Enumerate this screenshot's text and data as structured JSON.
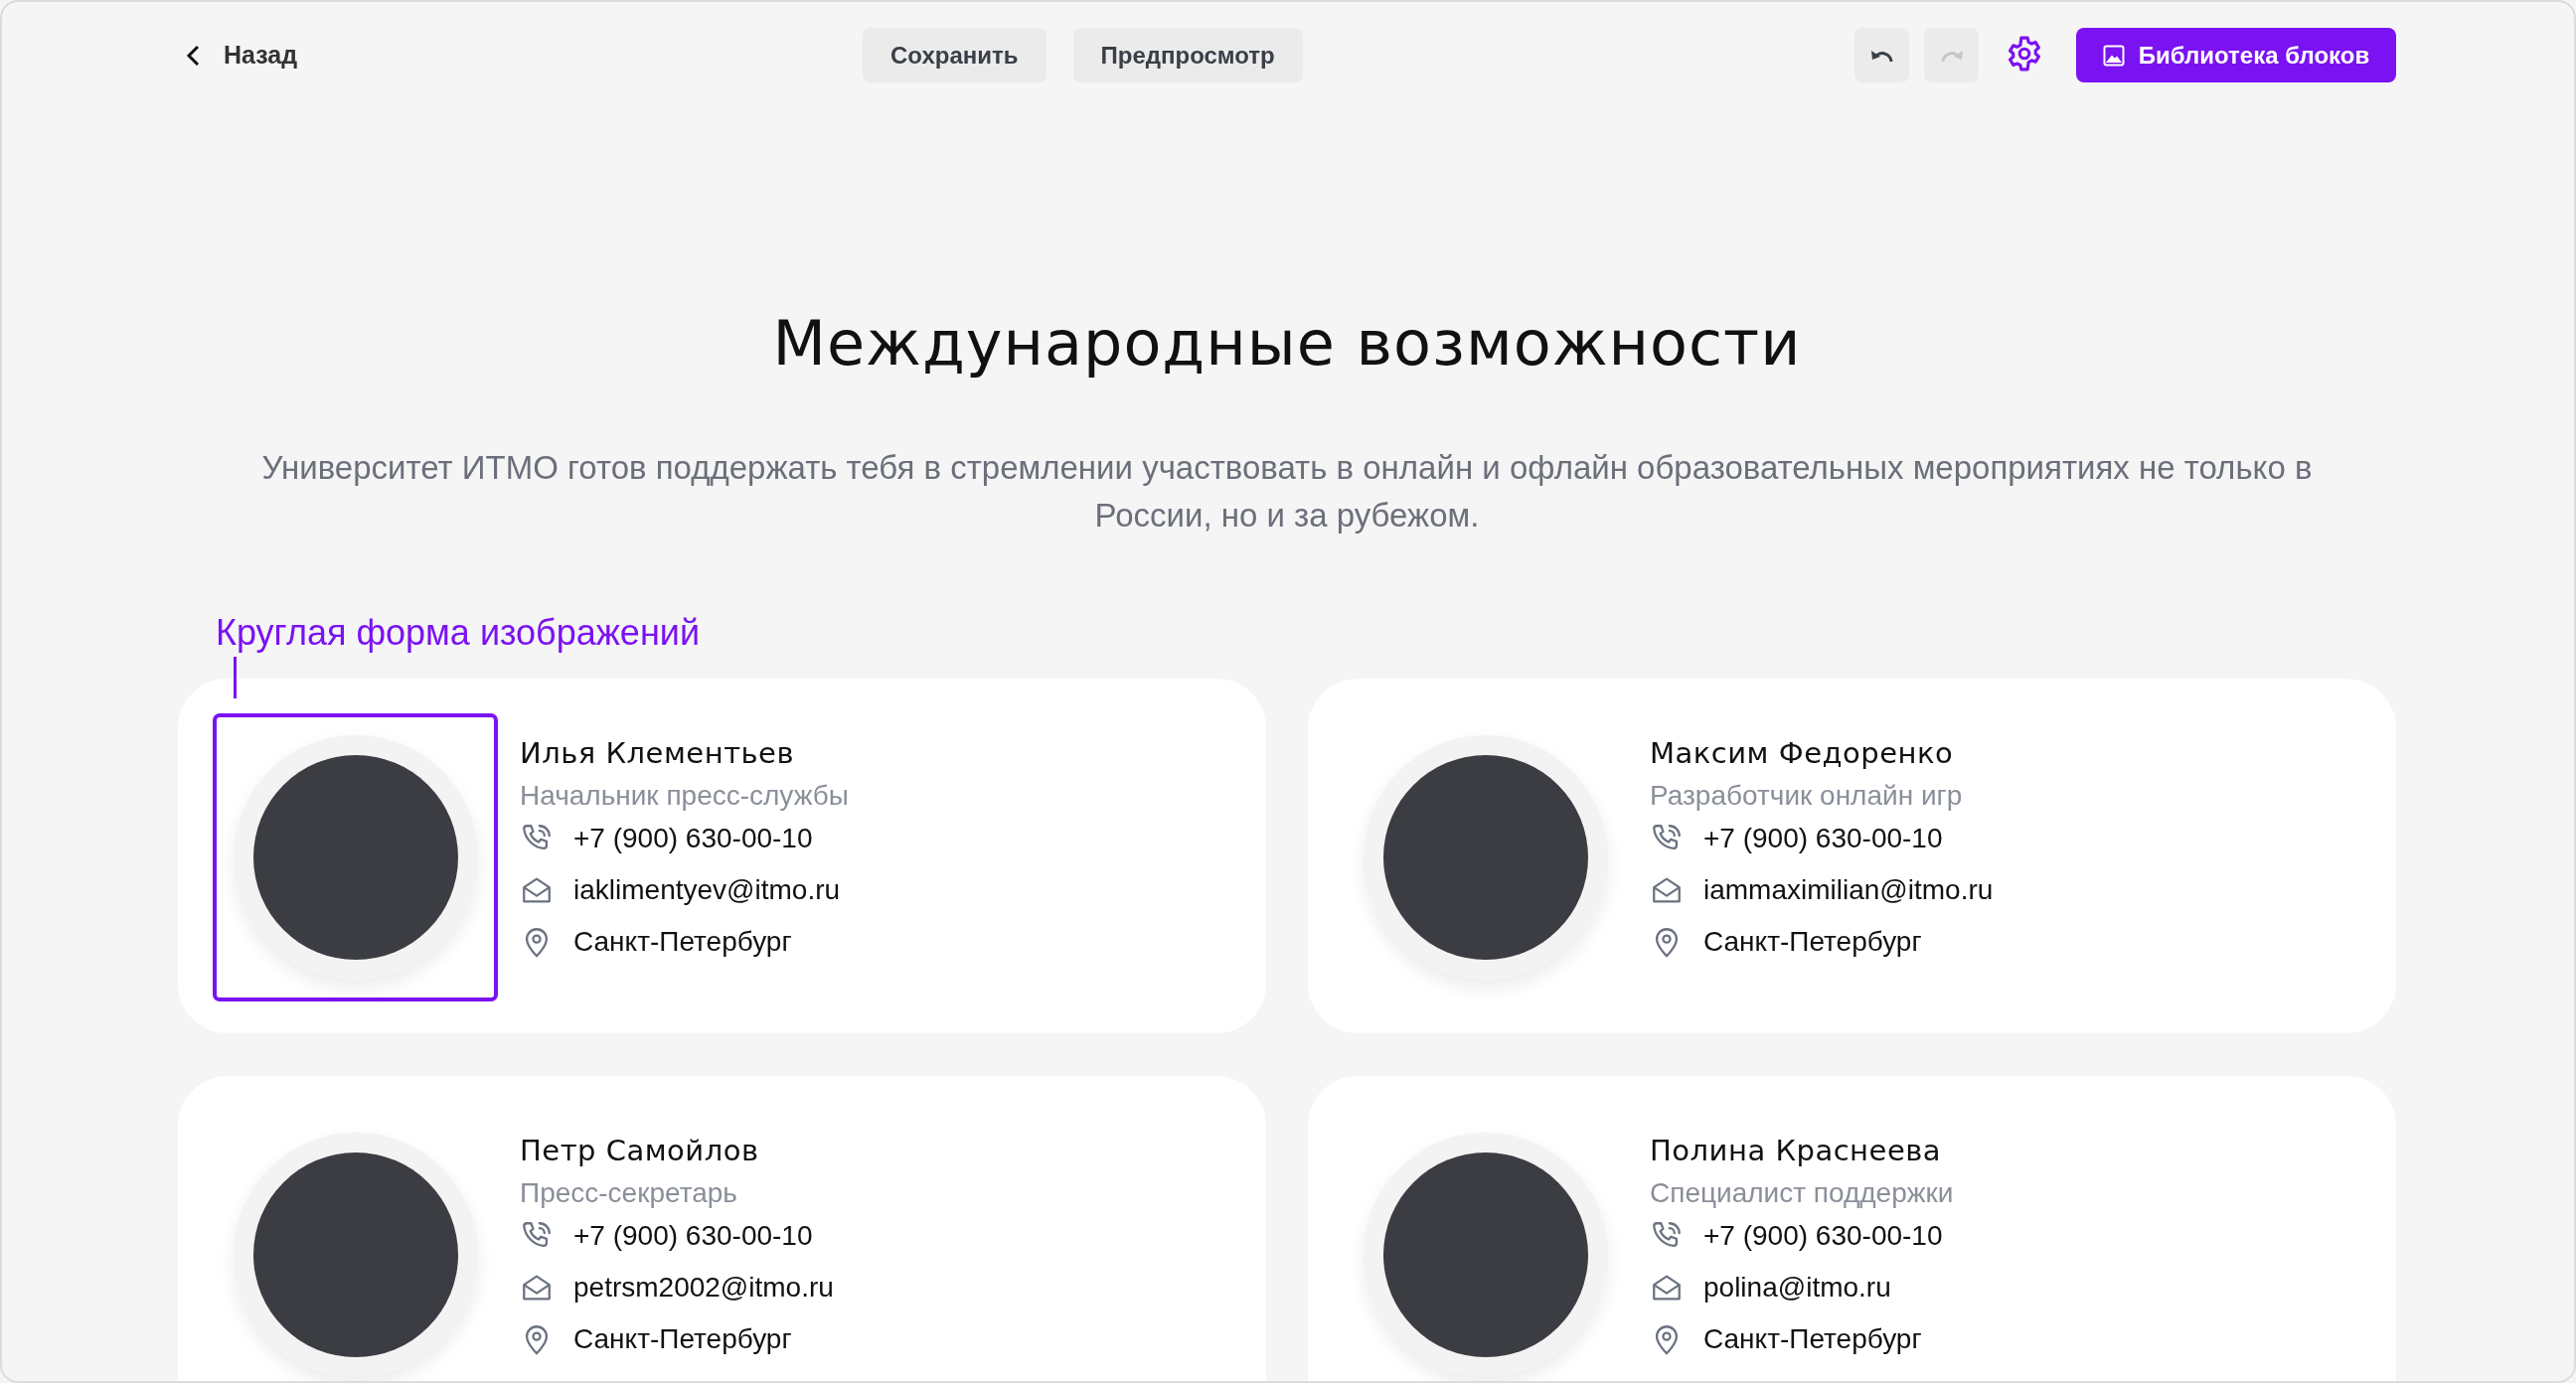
{
  "toolbar": {
    "back": "Назад",
    "buttons": [
      "Сохранить",
      "Предпросмотр"
    ],
    "undo": {
      "disabled": false
    },
    "redo": {
      "disabled": true
    },
    "library_button": "Библиотека блоков"
  },
  "heading": "Международные возможности",
  "description": "Университет ИТМО готов поддержать тебя в стремлении участвовать в онлайн и офлайн образовательных мероприятиях не только в России, но и за рубежом.",
  "annotation": "Круглая форма изображений",
  "cards": [
    {
      "name": "Илья Клементьев",
      "role": "Начальник пресс-службы",
      "phone": "+7 (900) 630-00-10",
      "email": "iaklimentyev@itmo.ru",
      "city": "Санкт-Петербург",
      "selected": true
    },
    {
      "name": "Максим Федоренко",
      "role": "Разработчик онлайн игр",
      "phone": "+7 (900) 630-00-10",
      "email": "iammaximilian@itmo.ru",
      "city": "Санкт-Петербург",
      "selected": false
    },
    {
      "name": "Петр Самойлов",
      "role": "Пресс-секретарь",
      "phone": "+7 (900) 630-00-10",
      "email": "petrsm2002@itmo.ru",
      "city": "Санкт-Петербург",
      "selected": false
    },
    {
      "name": "Полина Краснеева",
      "role": "Специалист поддержки",
      "phone": "+7 (900) 630-00-10",
      "email": "polina@itmo.ru",
      "city": "Санкт-Петербург",
      "selected": false
    }
  ]
}
